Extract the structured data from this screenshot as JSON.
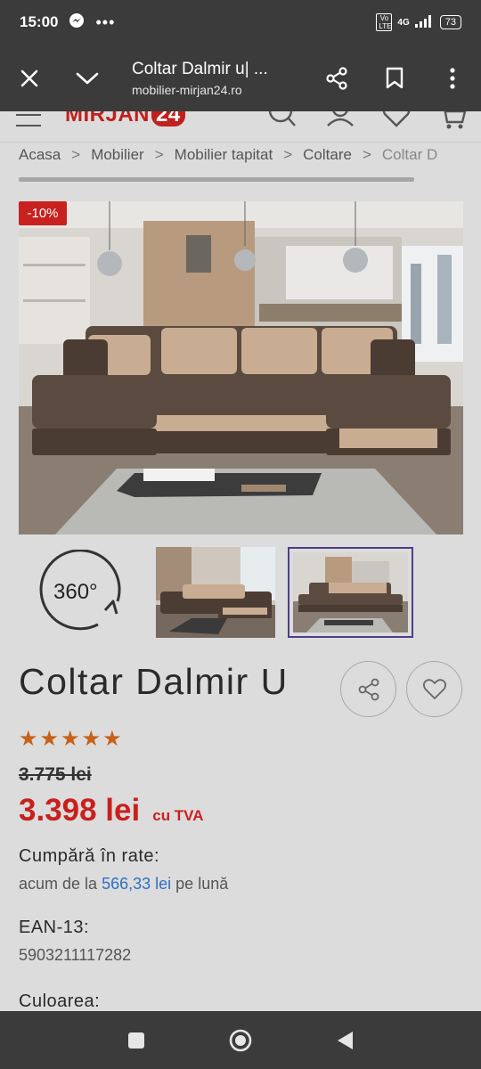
{
  "status": {
    "time": "15:00",
    "network": "4G",
    "volte": "Vo LTE",
    "battery": "73"
  },
  "browser": {
    "title": "Coltar Dalmir u| ...",
    "url": "mobilier-mirjan24.ro"
  },
  "site": {
    "logo_text": "MIRJAN",
    "logo_num": "24"
  },
  "breadcrumb": [
    "Acasa",
    "Mobilier",
    "Mobilier tapitat",
    "Coltare",
    "Coltar D"
  ],
  "product": {
    "discount": "-10%",
    "thumb_360_label": "360°",
    "title": "Coltar Dalmir U",
    "stars": "★★★★★",
    "rating": 5,
    "old_price": "3.775 lei",
    "new_price": "3.398 lei",
    "vat_label": "cu TVA",
    "rate_label": "Cumpără în rate:",
    "rate_prefix": "acum de la",
    "rate_amount": "566,33 lei",
    "rate_suffix": "pe lună",
    "ean_label": "EAN-13:",
    "ean_value": "5903211117282",
    "color_label": "Culoarea:"
  },
  "colors": {
    "brand_red": "#c8201e",
    "star_orange": "#c6611a",
    "link_blue": "#2f6fc4",
    "chrome_dark": "#3b3b3b"
  }
}
